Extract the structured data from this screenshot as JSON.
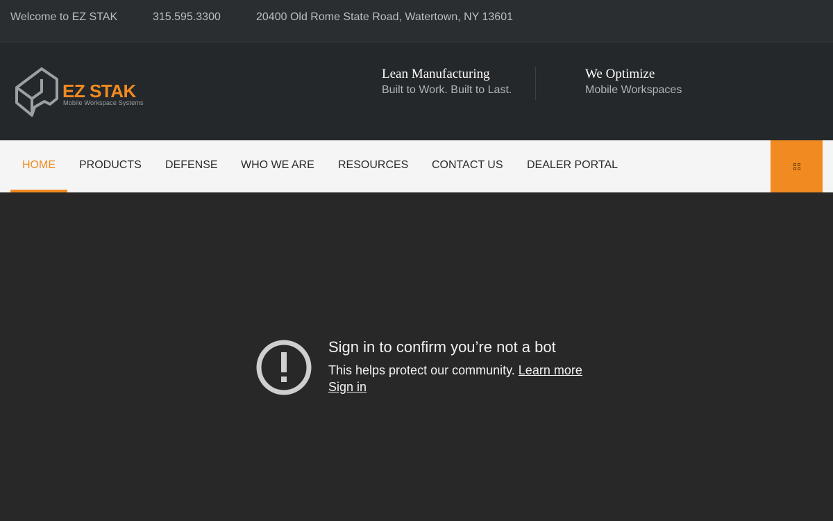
{
  "topbar": {
    "welcome": "Welcome to EZ STAK",
    "phone": "315.595.3300",
    "address": "20400 Old Rome State Road, Watertown, NY 13601"
  },
  "brand": {
    "name": "EZ STAK",
    "tagline": "Mobile Workspace Systems",
    "accent_color": "#f18a21"
  },
  "header": {
    "taglines": [
      {
        "title": "Lean Manufacturing",
        "subtitle": "Built to Work. Built to Last."
      },
      {
        "title": "We Optimize",
        "subtitle": "Mobile Workspaces"
      }
    ]
  },
  "nav": {
    "items": [
      {
        "label": "HOME",
        "active": true
      },
      {
        "label": "PRODUCTS"
      },
      {
        "label": "DEFENSE"
      },
      {
        "label": "WHO WE ARE"
      },
      {
        "label": "RESOURCES"
      },
      {
        "label": "CONTACT US"
      },
      {
        "label": "DEALER PORTAL"
      }
    ],
    "menu_icon": "grid-icon"
  },
  "embed": {
    "icon": "alert-circle-icon",
    "title": "Sign in to confirm you’re not a bot",
    "body": "This helps protect our community.",
    "learn_more": "Learn more",
    "sign_in": "Sign in"
  }
}
